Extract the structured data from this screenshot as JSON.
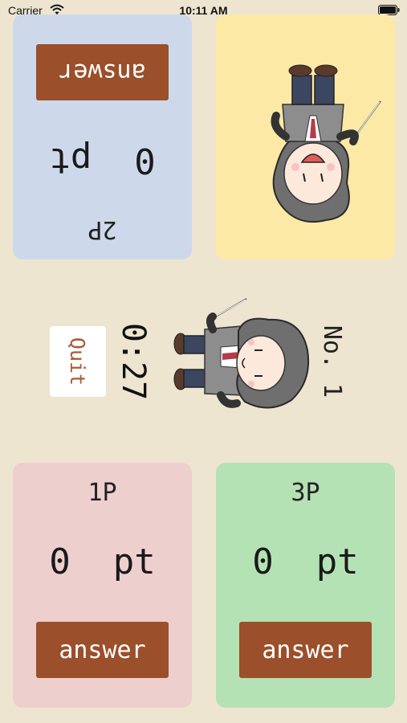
{
  "status_bar": {
    "carrier": "Carrier",
    "time": "10:11 AM",
    "wifi_icon": "wifi-icon",
    "battery_icon": "battery-icon"
  },
  "players": {
    "p1": {
      "name": "1P",
      "score": "0  pt",
      "answer_label": "answer",
      "color": "#edcfcd"
    },
    "p2": {
      "name": "2P",
      "score": "0  pt",
      "answer_label": "answer",
      "color": "#cdd9eb"
    },
    "p3": {
      "name": "3P",
      "score": "0  pt",
      "answer_label": "answer",
      "color": "#b4e2b4"
    },
    "p4": {
      "color": "#fde9a6",
      "image": "beethoven-conductor-illustration"
    }
  },
  "center": {
    "quit_label": "Quit",
    "timer": "0:27",
    "question_number": "No. 1",
    "mascot": "beethoven-conductor-illustration"
  },
  "colors": {
    "background": "#ede5d0",
    "answer_button": "#9b4f2a",
    "quit_text": "#a85a34"
  }
}
